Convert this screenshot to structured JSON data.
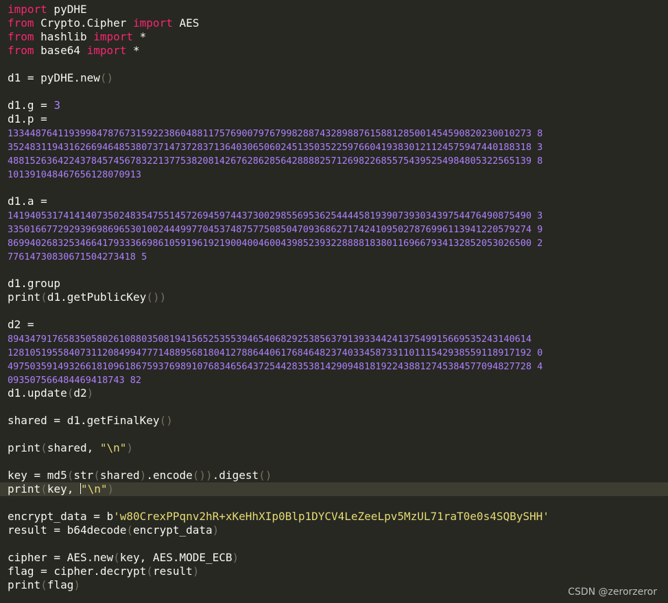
{
  "colors": {
    "background": "#272822",
    "current_line": "#3e3d32",
    "text": "#f8f8f2",
    "keyword": "#f92672",
    "number": "#ae81ff",
    "string": "#e6db74",
    "paren": "#75715e"
  },
  "cursor_line": 36,
  "lines": [
    [
      [
        "kw",
        "import"
      ],
      [
        "t",
        " pyDHE"
      ]
    ],
    [
      [
        "kw",
        "from"
      ],
      [
        "t",
        " Crypto.Cipher "
      ],
      [
        "kw",
        "import"
      ],
      [
        "t",
        " AES"
      ]
    ],
    [
      [
        "kw",
        "from"
      ],
      [
        "t",
        " hashlib "
      ],
      [
        "kw",
        "import"
      ],
      [
        "t",
        " *"
      ]
    ],
    [
      [
        "kw",
        "from"
      ],
      [
        "t",
        " base64 "
      ],
      [
        "kw",
        "import"
      ],
      [
        "t",
        " *"
      ]
    ],
    [],
    [
      [
        "t",
        "d1 = pyDHE.new"
      ],
      [
        "p",
        "()"
      ]
    ],
    [],
    [
      [
        "t",
        "d1.g = "
      ],
      [
        "num",
        "3"
      ]
    ],
    [
      [
        "t",
        "d1.p ="
      ]
    ],
    [
      [
        "numl",
        "1334487641193998478767315922386048811757690079767998288743289887615881285001454590820230010273 8"
      ]
    ],
    [
      [
        "numl",
        "3524831194316266946485380737147372837136403065060245135035225976604193830121124575947440188318 3"
      ]
    ],
    [
      [
        "numl",
        "4881526364224378457456783221377538208142676286285642888825712698226855754395254984805322565139 8"
      ]
    ],
    [
      [
        "numl",
        "101391048467656128070913"
      ]
    ],
    [],
    [
      [
        "t",
        "d1.a ="
      ]
    ],
    [
      [
        "numl",
        "1419405317414140735024835475514572694597443730029855695362544445819390739303439754476490875490 3"
      ]
    ],
    [
      [
        "numl",
        "3350166772929396986965301002444997704537487577508504709368627174241095027876996113941220579274 9"
      ]
    ],
    [
      [
        "numl",
        "8699402683253466417933366986105919619219004004600439852393228888183801169667934132852053026500 2"
      ]
    ],
    [
      [
        "numl",
        "77614730830671504273418 5"
      ]
    ],
    [],
    [
      [
        "t",
        "d1.group"
      ]
    ],
    [
      [
        "t",
        "print"
      ],
      [
        "p",
        "("
      ],
      [
        "t",
        "d1.getPublicKey"
      ],
      [
        "p",
        "())"
      ]
    ],
    [],
    [
      [
        "t",
        "d2 ="
      ]
    ],
    [
      [
        "numl",
        "8943479176583505802610880350819415652535539465406829253856379139334424137549915669535243140614"
      ]
    ],
    [
      [
        "numl",
        "1281051955840731120849947771488956818041278864406176846482374033458733110111542938559118917192 0"
      ]
    ],
    [
      [
        "numl",
        "4975035914932661810961867593769891076834656437254428353814290948181922438812745384577094827728 4"
      ]
    ],
    [
      [
        "numl",
        "093507566484469418743 82"
      ]
    ],
    [
      [
        "t",
        "d1.update"
      ],
      [
        "p",
        "("
      ],
      [
        "t",
        "d2"
      ],
      [
        "p",
        ")"
      ]
    ],
    [],
    [
      [
        "t",
        "shared = d1.getFinalKey"
      ],
      [
        "p",
        "()"
      ]
    ],
    [],
    [
      [
        "t",
        "print"
      ],
      [
        "p",
        "("
      ],
      [
        "t",
        "shared, "
      ],
      [
        "str",
        "\"\\n\""
      ],
      [
        "p",
        ")"
      ]
    ],
    [],
    [
      [
        "t",
        "key = md5"
      ],
      [
        "p",
        "("
      ],
      [
        "t",
        "str"
      ],
      [
        "p",
        "("
      ],
      [
        "t",
        "shared"
      ],
      [
        "p",
        ")"
      ],
      [
        "t",
        ".encode"
      ],
      [
        "p",
        "())"
      ],
      [
        "t",
        ".digest"
      ],
      [
        "p",
        "()"
      ]
    ],
    [
      [
        "t",
        "print"
      ],
      [
        "p",
        "("
      ],
      [
        "t",
        "key, "
      ],
      [
        "cur",
        ""
      ],
      [
        "str",
        "\"\\n\""
      ],
      [
        "p",
        ")"
      ]
    ],
    [],
    [
      [
        "t",
        "encrypt_data = b"
      ],
      [
        "str",
        "'w80CrexPPqnv2hR+xKeHhXIp0Blp1DYCV4LeZeeLpv5MzUL71raT0e0s4SQBySHH'"
      ]
    ],
    [
      [
        "t",
        "result = b64decode"
      ],
      [
        "p",
        "("
      ],
      [
        "t",
        "encrypt_data"
      ],
      [
        "p",
        ")"
      ]
    ],
    [],
    [
      [
        "t",
        "cipher = AES.new"
      ],
      [
        "p",
        "("
      ],
      [
        "t",
        "key, AES.MODE_ECB"
      ],
      [
        "p",
        ")"
      ]
    ],
    [
      [
        "t",
        "flag = cipher.decrypt"
      ],
      [
        "p",
        "("
      ],
      [
        "t",
        "result"
      ],
      [
        "p",
        ")"
      ]
    ],
    [
      [
        "t",
        "print"
      ],
      [
        "p",
        "("
      ],
      [
        "t",
        "flag"
      ],
      [
        "p",
        ")"
      ]
    ]
  ],
  "watermark": "CSDN @zerorzeror"
}
